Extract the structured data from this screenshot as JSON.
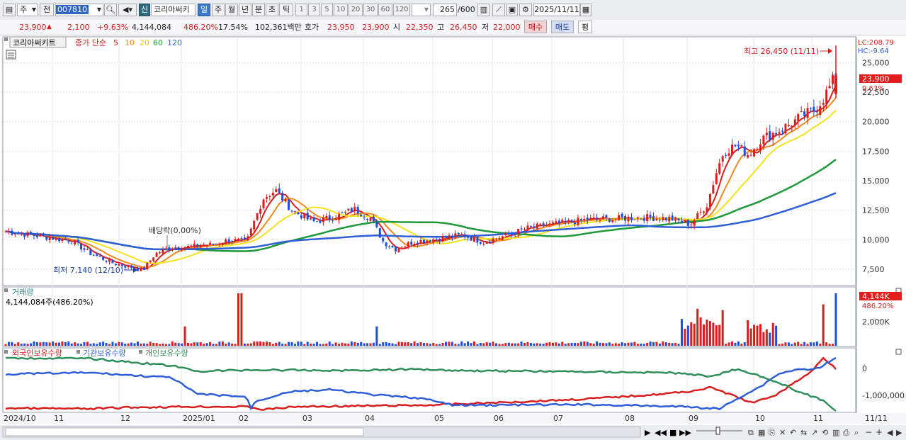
{
  "toolbar": {
    "market": "주",
    "prev_label": "전",
    "code": "007810",
    "name": "코리아써키",
    "badge_sin": "신",
    "periods": [
      "일",
      "주",
      "월",
      "년",
      "분",
      "초",
      "틱"
    ],
    "intervals": [
      "1",
      "3",
      "5",
      "10",
      "20",
      "30",
      "60",
      "120"
    ],
    "count": "265",
    "count_max": "/600",
    "date": "2025/11/11"
  },
  "quote": {
    "price": "23,900",
    "change": "2,100",
    "change_pct": "+9.63%",
    "volume": "4,144,084",
    "volume_ratio": "486.20%",
    "turnover": "17.54%",
    "amount": "102,361백만",
    "hoga_label": "호가",
    "ask": "23,950",
    "bid": "23,900",
    "open_label": "시",
    "open": "22,350",
    "high_label": "고",
    "high": "26,450",
    "low_label": "저",
    "low": "22,000",
    "buy_label": "매수",
    "sell_label": "매도",
    "eval_label": "평"
  },
  "price_panel": {
    "title": "코리아써키트",
    "ma_label": "종가 단순",
    "ma_periods": [
      "5",
      "10",
      "20",
      "60",
      "120"
    ],
    "ma_colors": [
      "#d81e1e",
      "#f08a1c",
      "#f5e11c",
      "#1f9a3a",
      "#2f5fd8"
    ],
    "lc": "LC:208.79",
    "hc": "HC:-9.64",
    "high_note": "최고 26,450 (11/11)",
    "low_note": "최저 7,140 (12/10)",
    "dividend_note": "배당락(0.00%)",
    "last_price": "23,900",
    "last_pct": "9.63%",
    "y_ticks": [
      "25,000",
      "22,500",
      "20,000",
      "17,500",
      "15,000",
      "12,500",
      "10,000",
      "7,500"
    ]
  },
  "volume_panel": {
    "title": "거래량",
    "value": "4,144,084주(486.20%)",
    "last": "4,144K",
    "last_pct": "486.20%",
    "y_ticks": [
      "2,000K"
    ]
  },
  "holdings_panel": {
    "legend": [
      "외국인보유수량",
      "기관보유수량",
      "개인보유수량"
    ],
    "colors": [
      "#d81e1e",
      "#2f5fd8",
      "#2f8f5a"
    ],
    "y_ticks": [
      "0",
      "-1,000,000"
    ]
  },
  "x_axis": {
    "labels": [
      "2024/10",
      "11",
      "12",
      "2025/01",
      "02",
      "03",
      "04",
      "05",
      "06",
      "07",
      "08",
      "09",
      "10",
      "11"
    ],
    "right_label": "11/11"
  },
  "chart_data": {
    "type": "candlestick",
    "title": "코리아써키트",
    "x_range": [
      "2024/10",
      "2025/11/11"
    ],
    "ylim": [
      6300,
      27000
    ],
    "y_ticks": [
      7500,
      10000,
      12500,
      15000,
      17500,
      20000,
      22500,
      25000
    ],
    "series": [
      {
        "name": "5",
        "color": "#d81e1e"
      },
      {
        "name": "10",
        "color": "#f08a1c"
      },
      {
        "name": "20",
        "color": "#f5e11c"
      },
      {
        "name": "60",
        "color": "#1f9a3a"
      },
      {
        "name": "120",
        "color": "#2f5fd8"
      }
    ],
    "last": {
      "open": 22350,
      "high": 26450,
      "low": 22000,
      "close": 23900,
      "volume": 4144084
    },
    "period_high": {
      "value": 26450,
      "date": "11/11"
    },
    "period_low": {
      "value": 7140,
      "date": "12/10"
    }
  }
}
